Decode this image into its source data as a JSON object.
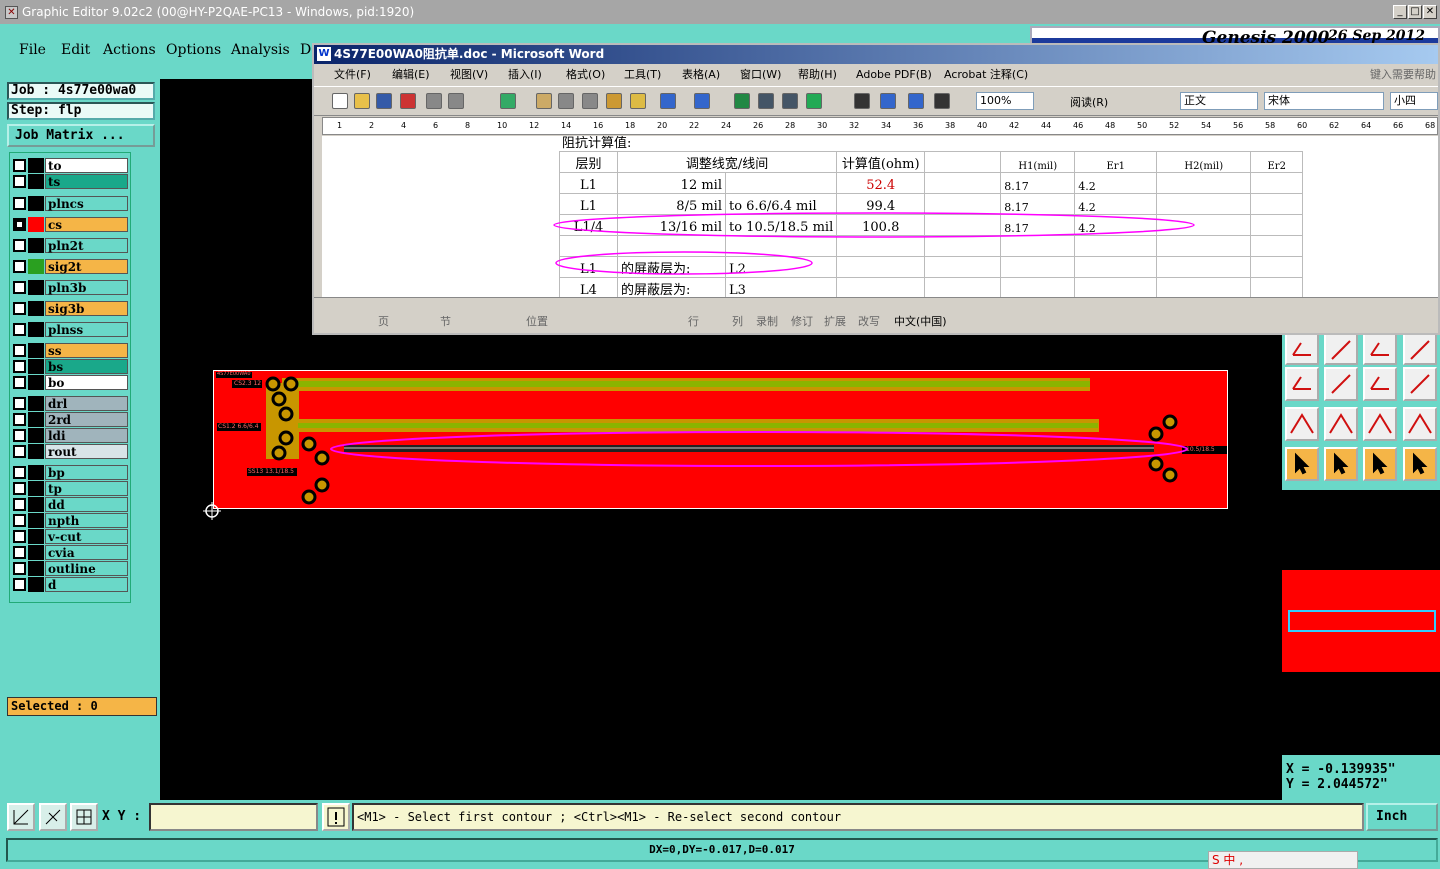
{
  "app": {
    "title": "Graphic Editor 9.02c2 (00@HY-P2QAE-PC13 - Windows, pid:1920)",
    "logo_text": "Genesis 2000",
    "logo_date": "26 Sep 2012"
  },
  "menu": [
    "File",
    "Edit",
    "Actions",
    "Options",
    "Analysis",
    "D"
  ],
  "job": {
    "job_label": "Job : 4s77e00wa0",
    "step_label": "Step: flp",
    "matrix_button": "Job Matrix ..."
  },
  "layers": [
    {
      "name": "to",
      "color": "#ffffff",
      "active": false
    },
    {
      "name": "ts",
      "color": "#1aa88a",
      "active": false
    },
    {
      "name": "plncs",
      "color": "#6ad8c8",
      "active": false
    },
    {
      "name": "cs",
      "color": "#f5b547",
      "active": true
    },
    {
      "name": "pln2t",
      "color": "#6ad8c8",
      "active": false
    },
    {
      "name": "sig2t",
      "color": "#f5b547",
      "active": false
    },
    {
      "name": "pln3b",
      "color": "#6ad8c8",
      "active": false
    },
    {
      "name": "sig3b",
      "color": "#f5b547",
      "active": false
    },
    {
      "name": "plnss",
      "color": "#6ad8c8",
      "active": false
    },
    {
      "name": "ss",
      "color": "#f5b547",
      "active": false
    },
    {
      "name": "bs",
      "color": "#1aa88a",
      "active": false
    },
    {
      "name": "bo",
      "color": "#ffffff",
      "active": false
    },
    {
      "name": "drl",
      "color": "#a0b4bc",
      "active": false
    },
    {
      "name": "2rd",
      "color": "#a0b4bc",
      "active": false
    },
    {
      "name": "ldi",
      "color": "#a0b4bc",
      "active": false
    },
    {
      "name": "rout",
      "color": "#d8e4e8",
      "active": false
    },
    {
      "name": "bp",
      "color": "#6ad8c8",
      "active": false
    },
    {
      "name": "tp",
      "color": "#6ad8c8",
      "active": false
    },
    {
      "name": "dd",
      "color": "#6ad8c8",
      "active": false
    },
    {
      "name": "npth",
      "color": "#6ad8c8",
      "active": false
    },
    {
      "name": "v-cut",
      "color": "#6ad8c8",
      "active": false
    },
    {
      "name": "cvia",
      "color": "#6ad8c8",
      "active": false
    },
    {
      "name": "outline",
      "color": "#6ad8c8",
      "active": false
    },
    {
      "name": "d",
      "color": "#6ad8c8",
      "active": false
    }
  ],
  "selected": "Selected : 0",
  "coords": {
    "x": "X = -0.139935\"",
    "y": "Y = 2.044572\""
  },
  "bottom": {
    "xy_label": "X Y :",
    "xy_value": "",
    "prompt": "<M1> - Select first contour ; <Ctrl><M1> - Re-select second contour",
    "unit": "Inch",
    "status": "DX=0,DY=-0.017,D=0.017",
    "ime": "S 中 ,"
  },
  "word": {
    "title": "4S77E00WA0阻抗单.doc - Microsoft Word",
    "menu": [
      "文件(F)",
      "编辑(E)",
      "视图(V)",
      "插入(I)",
      "格式(O)",
      "工具(T)",
      "表格(A)",
      "窗口(W)",
      "帮助(H)",
      "Adobe PDF(B)",
      "Acrobat 注释(C)"
    ],
    "help_box": "键入需要帮助",
    "zoom": "100%",
    "read_button": "阅读(R)",
    "style": "正文",
    "font": "宋体",
    "size": "小四",
    "heading": "阻抗计算值:",
    "table_header": [
      "层别",
      "调整线宽/线间",
      "计算值(ohm)",
      "",
      "H1(mil)",
      "Er1",
      "H2(mil)",
      "Er2"
    ],
    "rows": [
      [
        "L1",
        "12 mil",
        "",
        "52.4",
        "",
        "8.17",
        "4.2",
        "",
        ""
      ],
      [
        "L1",
        "8/5 mil",
        "to 6.6/6.4 mil",
        "99.4",
        "",
        "8.17",
        "4.2",
        "",
        ""
      ],
      [
        "L1/4",
        "13/16 mil",
        "to 10.5/18.5 mil",
        "100.8",
        "",
        "8.17",
        "4.2",
        "",
        ""
      ],
      [
        "",
        "",
        "",
        "",
        "",
        "",
        "",
        "",
        ""
      ],
      [
        "L1",
        "的屏蔽层为:",
        "L2",
        "",
        "",
        "",
        "",
        "",
        ""
      ],
      [
        "L4",
        "的屏蔽层为:",
        "L3",
        "",
        "",
        "",
        "",
        "",
        ""
      ]
    ],
    "status": [
      "页",
      "节",
      "位置",
      "行",
      "列",
      "录制",
      "修订",
      "扩展",
      "改写",
      "中文(中国)"
    ],
    "ruler_ticks": [
      "1",
      "2",
      "4",
      "6",
      "8",
      "10",
      "12",
      "14",
      "16",
      "18",
      "20",
      "22",
      "24",
      "26",
      "28",
      "30",
      "32",
      "34",
      "36",
      "38",
      "40",
      "42",
      "44",
      "46",
      "48",
      "50",
      "52",
      "54",
      "56",
      "58",
      "60",
      "62",
      "64",
      "66",
      "68"
    ]
  },
  "board": {
    "labels": [
      "4S77E00WA0",
      "CS2.3 12",
      "CS1.2 6.6/6.4",
      "SS13 13.1/18.5",
      "10.5/18.5"
    ]
  },
  "colors": {
    "panel": "#6ad8c8",
    "board": "#ff0000",
    "trace": "#8ab400",
    "pad": "#c89600",
    "highlight": "#ff00ff"
  }
}
